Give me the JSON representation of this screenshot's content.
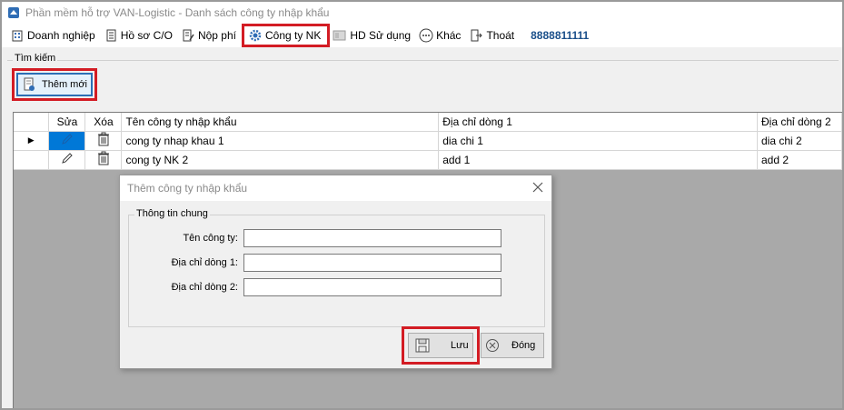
{
  "window": {
    "title": "Phần mềm hỗ trợ VAN-Logistic - Danh sách công ty nhập khẩu"
  },
  "menu": {
    "items": [
      {
        "label": "Doanh nghiệp",
        "icon": "building-icon"
      },
      {
        "label": "Hồ sơ C/O",
        "icon": "document-icon"
      },
      {
        "label": "Nộp phí",
        "icon": "edit-document-icon"
      },
      {
        "label": "Công ty NK",
        "icon": "gear-icon"
      },
      {
        "label": "HD Sử dụng",
        "icon": "help-icon"
      },
      {
        "label": "Khác",
        "icon": "more-icon"
      },
      {
        "label": "Thoát",
        "icon": "exit-icon"
      }
    ],
    "phone": "8888811111"
  },
  "search": {
    "legend": "Tìm kiếm",
    "add_button": "Thêm mới"
  },
  "grid": {
    "columns": [
      "Sửa",
      "Xóa",
      "Tên công ty nhập khẩu",
      "Địa chỉ dòng 1",
      "Địa chỉ dòng 2"
    ],
    "rows": [
      {
        "name": "cong ty nhap khau 1",
        "addr1": "dia chi 1",
        "addr2": "dia chi 2"
      },
      {
        "name": "cong ty NK 2",
        "addr1": "add 1",
        "addr2": "add 2"
      }
    ]
  },
  "dialog": {
    "title": "Thêm công ty nhập khẩu",
    "group_legend": "Thông tin chung",
    "fields": {
      "company_label": "Tên công ty:",
      "company_value": "",
      "addr1_label": "Địa chỉ dòng 1:",
      "addr1_value": "",
      "addr2_label": "Địa chỉ dòng 2:",
      "addr2_value": ""
    },
    "save_label": "Lưu",
    "close_label": "Đóng"
  },
  "colors": {
    "highlight": "#d31c24",
    "selection": "#0078d7",
    "phone": "#1a4f8a"
  }
}
